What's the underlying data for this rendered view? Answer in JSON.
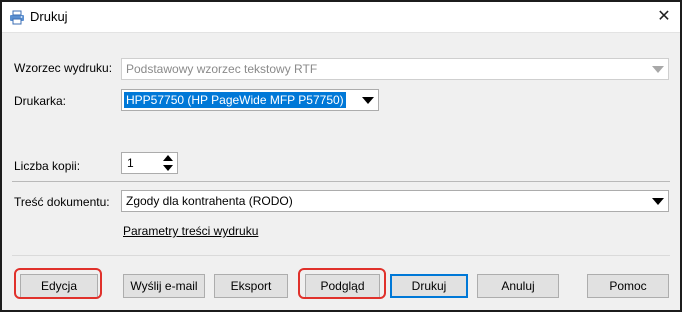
{
  "window": {
    "title": "Drukuj",
    "close_glyph": "✕"
  },
  "form": {
    "template_label": "Wzorzec wydruku:",
    "template_value": "Podstawowy wzorzec tekstowy RTF",
    "printer_label": "Drukarka:",
    "printer_value": "HPP57750 (HP PageWide MFP P57750)",
    "copies_label": "Liczba kopii:",
    "copies_value": "1",
    "content_label": "Treść dokumentu:",
    "content_value": "Zgody dla kontrahenta (RODO)",
    "params_link": "Parametry treści wydruku"
  },
  "buttons": {
    "edit": "Edycja",
    "email": "Wyślij e-mail",
    "export": "Eksport",
    "preview": "Podgląd",
    "print": "Drukuj",
    "cancel": "Anuluj",
    "help": "Pomoc"
  },
  "colors": {
    "highlight": "#e0312b",
    "selection": "#0078d7"
  },
  "icons": {
    "app": "printer-app-icon",
    "close": "close-icon"
  }
}
